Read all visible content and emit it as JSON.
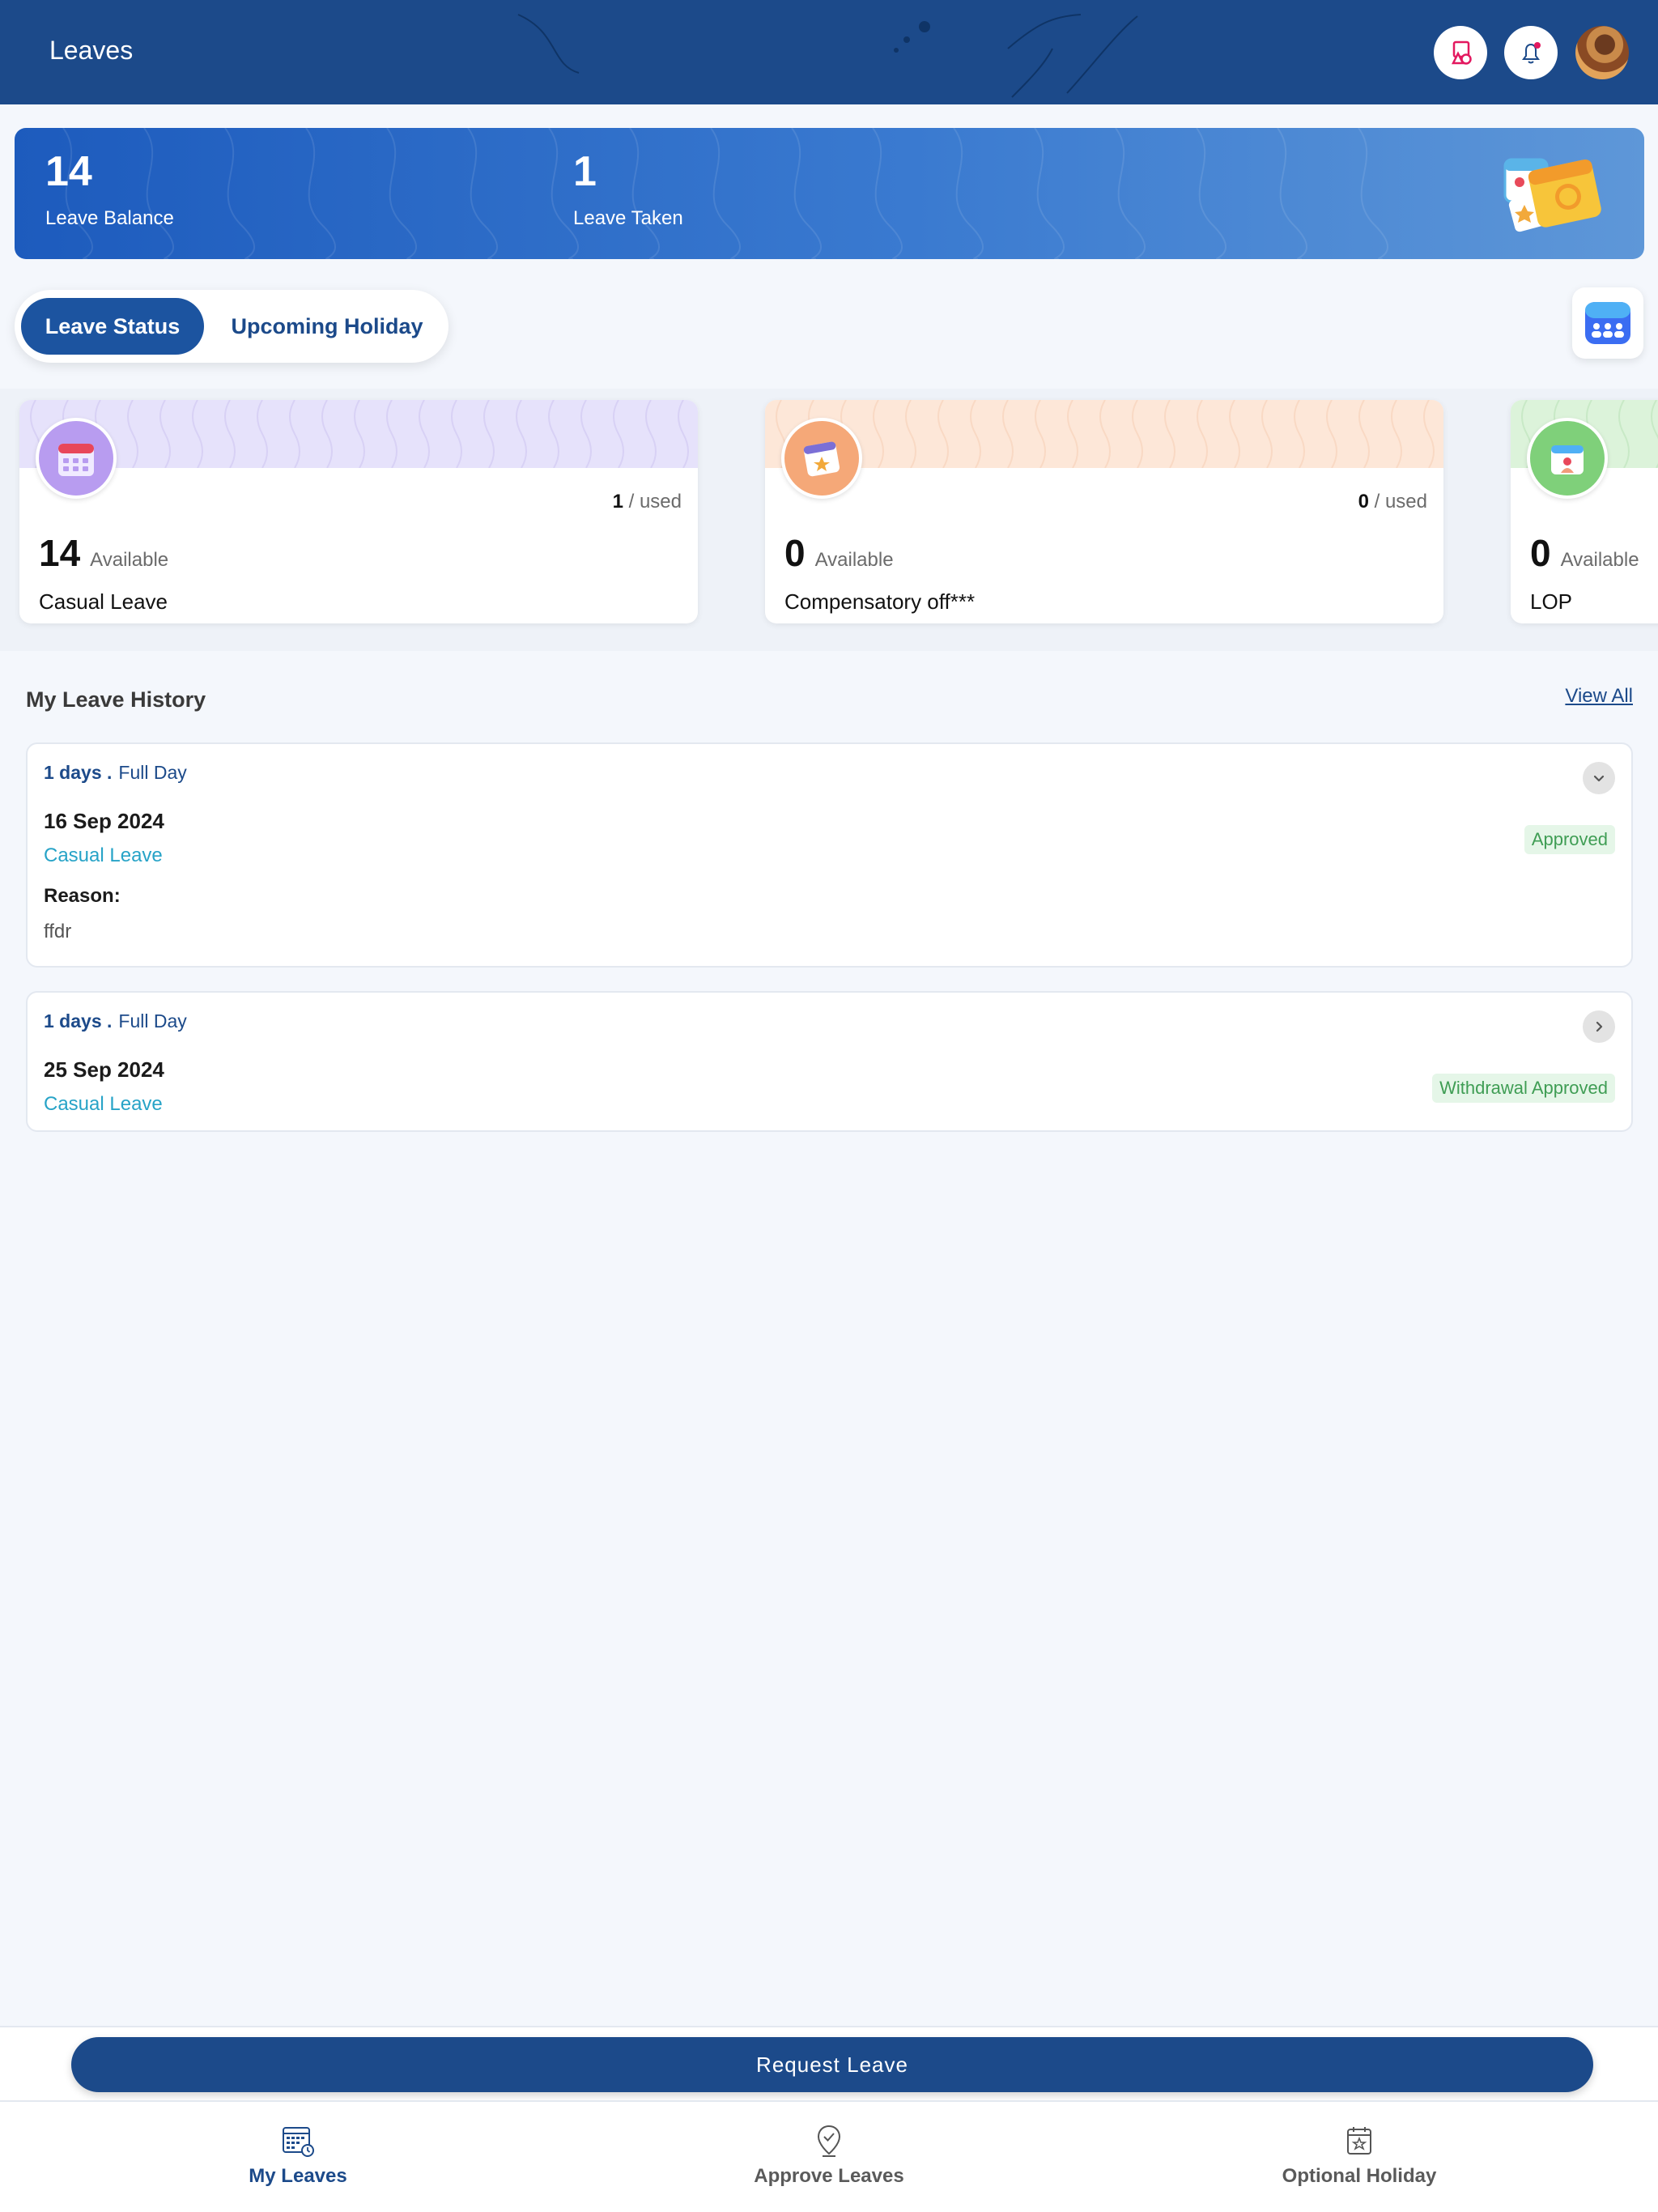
{
  "header": {
    "title": "Leaves",
    "icons": [
      "shapes-icon",
      "bell-icon",
      "avatar"
    ]
  },
  "summary": {
    "balance_value": "14",
    "balance_label": "Leave Balance",
    "taken_value": "1",
    "taken_label": "Leave Taken"
  },
  "tabs": [
    {
      "label": "Leave Status",
      "active": true
    },
    {
      "label": "Upcoming Holiday",
      "active": false
    }
  ],
  "leave_types": [
    {
      "name": "Casual Leave",
      "available": "14",
      "available_label": "Available",
      "used": "1",
      "used_label": "/ used",
      "color": "#b89cf0"
    },
    {
      "name": "Compensatory off***",
      "available": "0",
      "available_label": "Available",
      "used": "0",
      "used_label": "/ used",
      "color": "#f5a878"
    },
    {
      "name": "LOP",
      "available": "0",
      "available_label": "Available",
      "used": "",
      "used_label": "",
      "color": "#7fd07a"
    }
  ],
  "history": {
    "title": "My Leave History",
    "view_all": "View All",
    "items": [
      {
        "days": "1 days .",
        "type": "Full Day",
        "date": "16 Sep 2024",
        "leave_type": "Casual Leave",
        "status": "Approved",
        "reason_label": "Reason:",
        "reason": "ffdr",
        "expanded": true
      },
      {
        "days": "1 days .",
        "type": "Full Day",
        "date": "25 Sep 2024",
        "leave_type": "Casual Leave",
        "status": "Withdrawal Approved",
        "expanded": false
      }
    ]
  },
  "actions": {
    "request_leave": "Request Leave"
  },
  "bottom_nav": [
    {
      "label": "My Leaves",
      "icon": "calendar-grid-icon",
      "active": true
    },
    {
      "label": "Approve Leaves",
      "icon": "location-check-icon",
      "active": false
    },
    {
      "label": "Optional Holiday",
      "icon": "calendar-star-icon",
      "active": false
    }
  ],
  "colors": {
    "primary": "#1c4a8a",
    "accent_blue": "#1d5bbd",
    "leave_type_link": "#27a3c7",
    "approved_green": "#3f9d54"
  }
}
